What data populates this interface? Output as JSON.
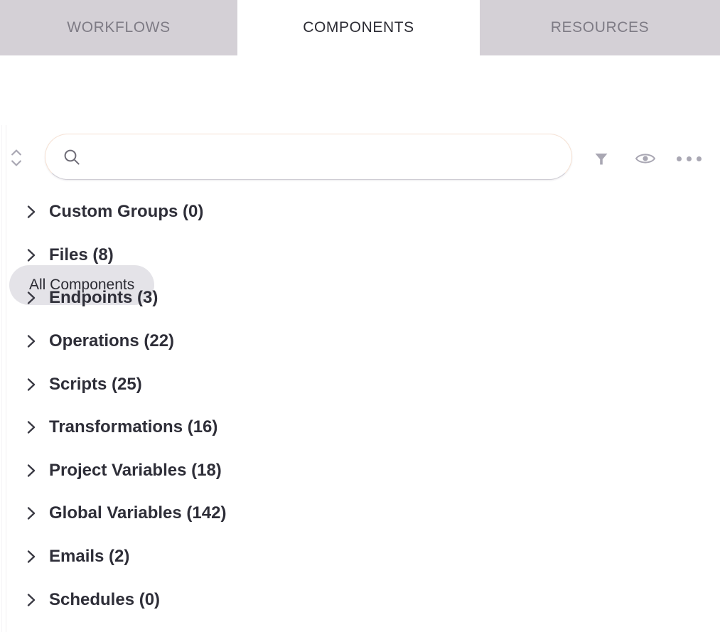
{
  "tabs": [
    {
      "label": "WORKFLOWS",
      "active": false
    },
    {
      "label": "COMPONENTS",
      "active": true
    },
    {
      "label": "RESOURCES",
      "active": false
    }
  ],
  "toolbar": {
    "collapse_toggle_name": "expand-collapse-all",
    "search": {
      "value": "",
      "placeholder": ""
    },
    "filter_label": "Filter",
    "visibility_label": "Visibility",
    "more_label": "More options"
  },
  "filter_chips": [
    {
      "label": "All Components",
      "selected": true
    }
  ],
  "tree": {
    "items": [
      {
        "label": "Custom Groups (0)",
        "name": "custom-groups",
        "count": 0,
        "expanded": false
      },
      {
        "label": "Files (8)",
        "name": "files",
        "count": 8,
        "expanded": false
      },
      {
        "label": "Endpoints (3)",
        "name": "endpoints",
        "count": 3,
        "expanded": false
      },
      {
        "label": "Operations (22)",
        "name": "operations",
        "count": 22,
        "expanded": false
      },
      {
        "label": "Scripts (25)",
        "name": "scripts",
        "count": 25,
        "expanded": false
      },
      {
        "label": "Transformations (16)",
        "name": "transformations",
        "count": 16,
        "expanded": false
      },
      {
        "label": "Project Variables (18)",
        "name": "project-variables",
        "count": 18,
        "expanded": false
      },
      {
        "label": "Global Variables (142)",
        "name": "global-variables",
        "count": 142,
        "expanded": false
      },
      {
        "label": "Emails (2)",
        "name": "emails",
        "count": 2,
        "expanded": false
      },
      {
        "label": "Schedules (0)",
        "name": "schedules",
        "count": 0,
        "expanded": false
      }
    ]
  },
  "colors": {
    "tab_inactive_bg": "#d4d0d6",
    "tab_inactive_text": "#7e7b85",
    "tab_active_text": "#2b2b33",
    "chip_bg": "#e4e3e8",
    "search_border": "#f6e2d4",
    "icon_gray": "#a9a7b3",
    "tree_text": "#2e2e38"
  }
}
